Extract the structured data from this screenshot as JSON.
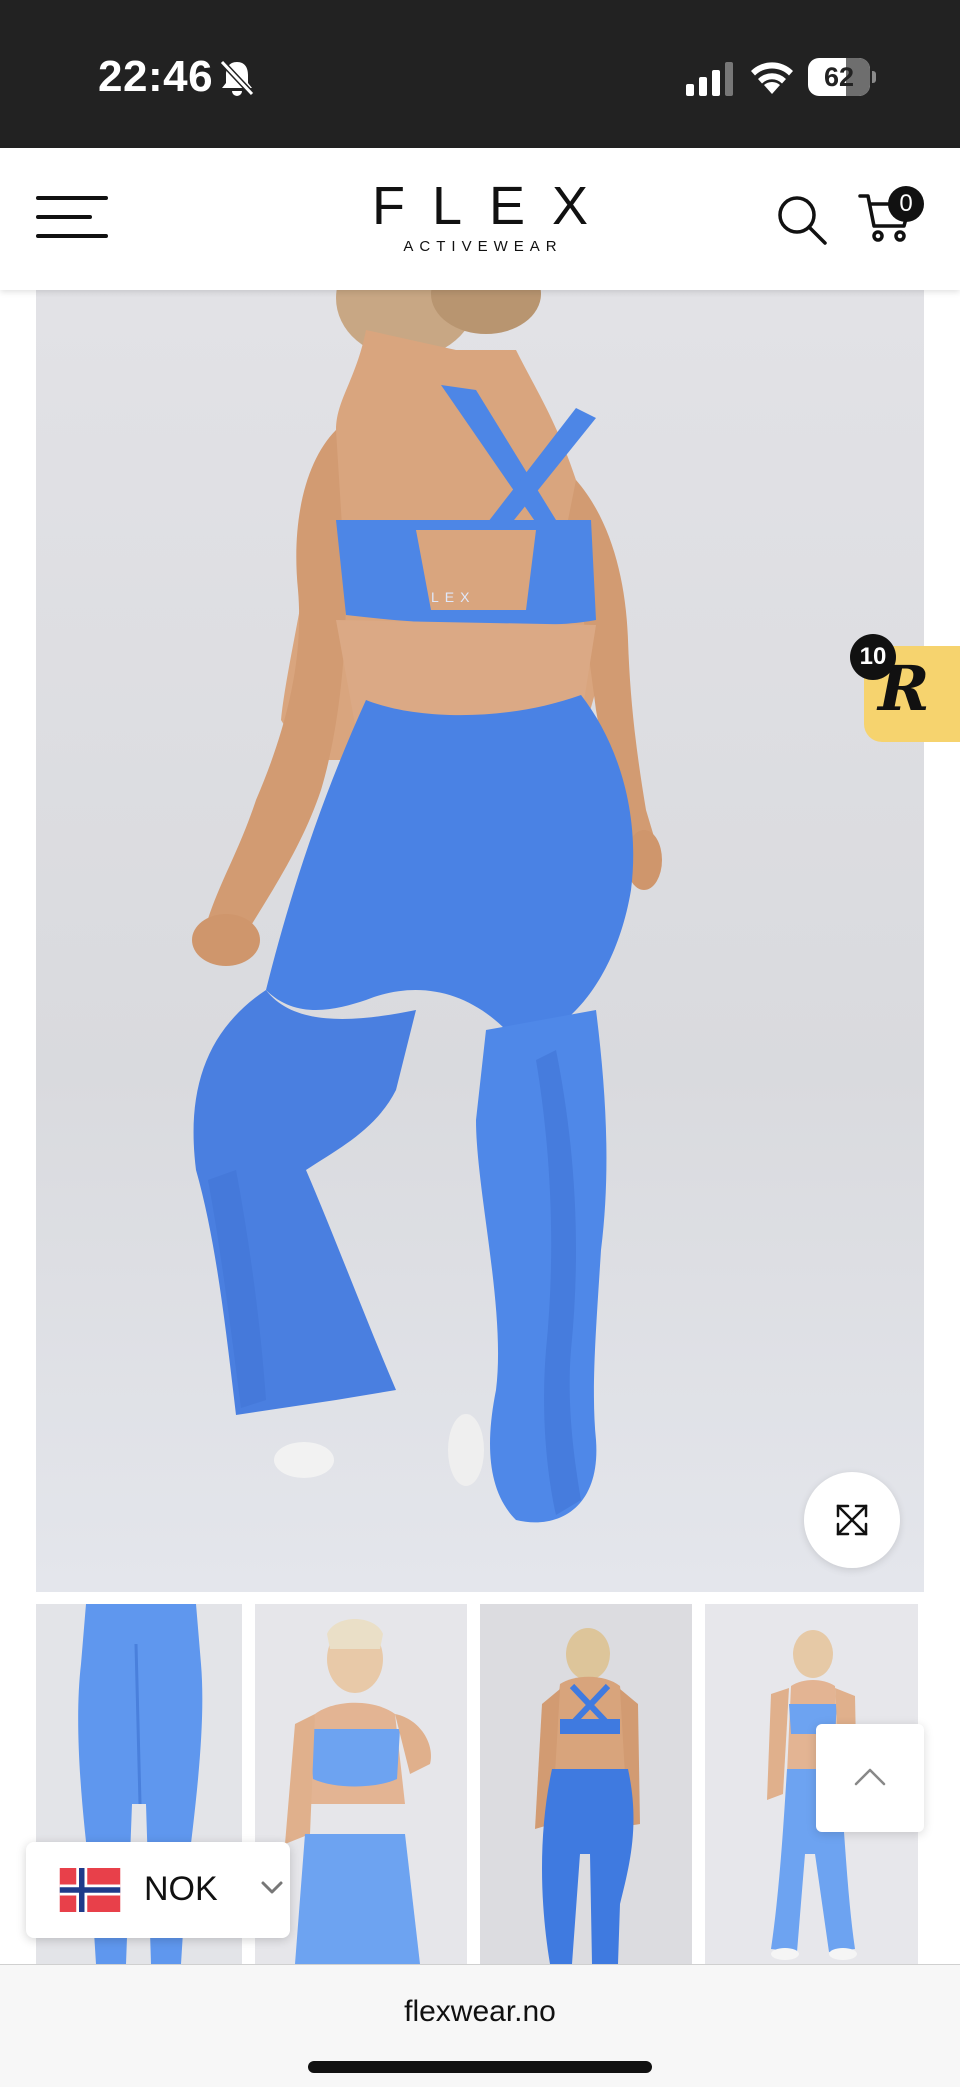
{
  "status_bar": {
    "time": "22:46",
    "battery": "62",
    "battery_level": 0.62,
    "icons": [
      "bell-slash-icon",
      "cellular-signal-icon",
      "wifi-icon",
      "battery-icon"
    ]
  },
  "header": {
    "brand": "FLEX",
    "brand_sub": "ACTIVEWEAR",
    "cart_count": "0",
    "icons": [
      "hamburger-menu-icon",
      "search-icon",
      "cart-icon"
    ]
  },
  "gallery": {
    "main_image": "product-photo-back-view",
    "thumbnails": [
      "thumbnail-leggings-back",
      "thumbnail-front-view",
      "thumbnail-back-view",
      "thumbnail-full-front"
    ],
    "zoom_icon": "expand-icon"
  },
  "rewards": {
    "badge_count": "10",
    "letter": "R"
  },
  "currency": {
    "code": "NOK",
    "flag": "norway-flag"
  },
  "browser": {
    "url": "flexwear.no"
  },
  "colors": {
    "status_bar_bg": "#222222",
    "product_blue": "#4d86e6",
    "rewards_yellow": "#f6d36e",
    "norway_red": "#e8404a",
    "norway_blue": "#1f3a8a"
  }
}
